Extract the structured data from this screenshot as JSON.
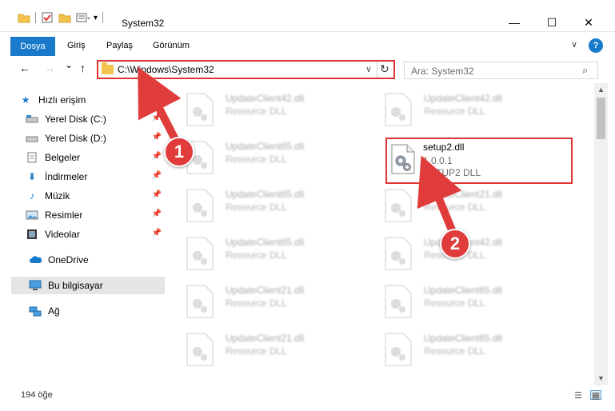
{
  "window": {
    "title": "System32",
    "minimize_glyph": "—",
    "maximize_glyph": "☐",
    "close_glyph": "✕"
  },
  "ribbon": {
    "tabs": [
      "Dosya",
      "Giriş",
      "Paylaş",
      "Görünüm"
    ],
    "help_glyph": "?",
    "collapse_glyph": "∨"
  },
  "navigation": {
    "back_glyph": "←",
    "forward_glyph": "→",
    "recent_glyph": "⌄",
    "up_glyph": "↑"
  },
  "address": {
    "path": "C:\\Windows\\System32",
    "dropdown_glyph": "∨",
    "refresh_glyph": "↻"
  },
  "search": {
    "placeholder": "Ara: System32",
    "icon_glyph": "⌕"
  },
  "sidebar": {
    "items": [
      {
        "label": "Hızlı erişim",
        "icon": "star-icon"
      },
      {
        "label": "Yerel Disk (C:)",
        "icon": "drive-icon",
        "pinned": true
      },
      {
        "label": "Yerel Disk (D:)",
        "icon": "drive-icon",
        "pinned": true
      },
      {
        "label": "Belgeler",
        "icon": "documents-icon",
        "pinned": true
      },
      {
        "label": "İndirmeler",
        "icon": "download-icon",
        "pinned": true
      },
      {
        "label": "Müzik",
        "icon": "music-icon",
        "pinned": true
      },
      {
        "label": "Resimler",
        "icon": "pictures-icon",
        "pinned": true
      },
      {
        "label": "Videolar",
        "icon": "video-icon",
        "pinned": true
      },
      {
        "label": "OneDrive",
        "icon": "cloud-icon"
      },
      {
        "label": "Bu bilgisayar",
        "icon": "computer-icon",
        "selected": true
      },
      {
        "label": "Ağ",
        "icon": "network-icon"
      }
    ]
  },
  "files": {
    "blurred": [
      {
        "name": "UpdateClient42.dll",
        "desc": "Resource DLL"
      },
      {
        "name": "UpdateClient42.dll",
        "desc": "Resource DLL"
      },
      {
        "name": "UpdateClient65.dll",
        "desc": "Resource DLL"
      },
      {
        "name": "UpdateClient65.dll",
        "desc": "Resource DLL"
      },
      {
        "name": "UpdateClient21.dll",
        "desc": "Resource DLL"
      },
      {
        "name": "UpdateClient65.dll",
        "desc": "Resource DLL"
      },
      {
        "name": "UpdateClient42.dll",
        "desc": "Resource DLL"
      },
      {
        "name": "UpdateClient21.dll",
        "desc": "Resource DLL"
      },
      {
        "name": "UpdateClient65.dll",
        "desc": "Resource DLL"
      },
      {
        "name": "UpdateClient21.dll",
        "desc": "Resource DLL"
      },
      {
        "name": "UpdateClient65.dll",
        "desc": "Resource DLL"
      }
    ],
    "highlighted": {
      "name": "setup2.dll",
      "version": "1.0.0.1",
      "description": "SETUP2 DLL"
    }
  },
  "status": {
    "count_text": "194 öğe"
  },
  "annotations": {
    "step1": "1",
    "step2": "2",
    "color": "#e03c3c"
  },
  "colors": {
    "accent": "#1979ca",
    "highlight_border": "#e03333",
    "selected_bg": "#e5e5e5"
  }
}
